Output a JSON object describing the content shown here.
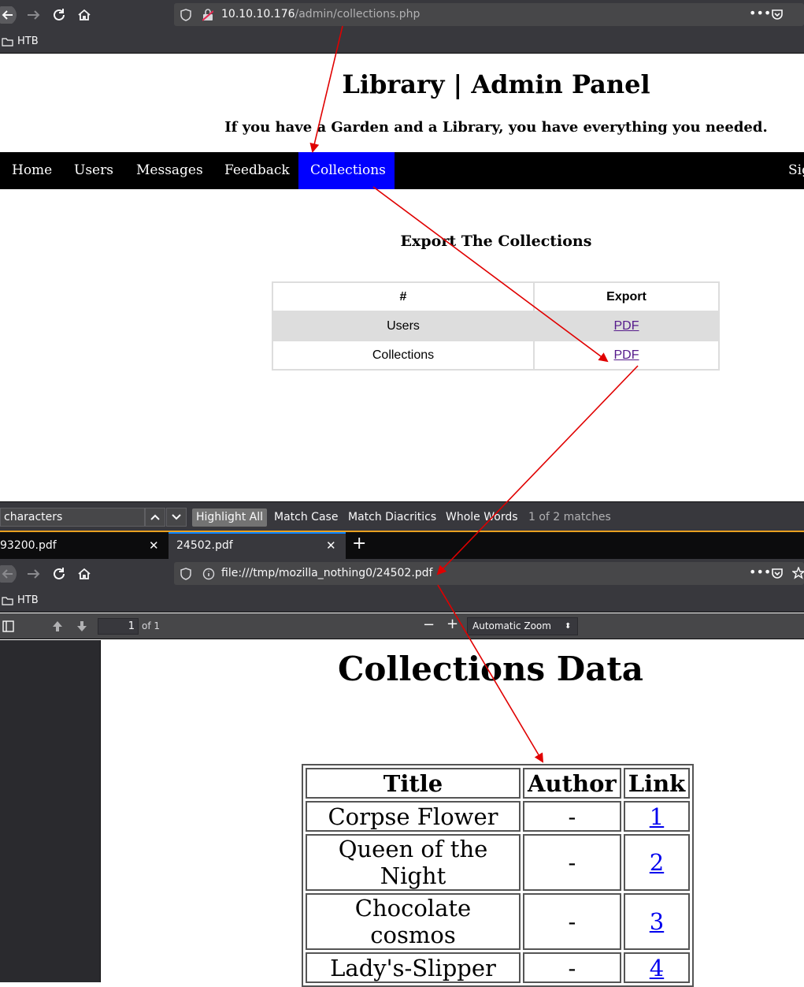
{
  "browser_top": {
    "url_host": "10.10.10.176",
    "url_path": "/admin/collections.php",
    "bookmark": "HTB"
  },
  "admin": {
    "title": "Library | Admin Panel",
    "subtitle": "If you have a Garden and a Library, you have everything you needed.",
    "nav": [
      "Home",
      "Users",
      "Messages",
      "Feedback",
      "Collections",
      "Sig"
    ],
    "active_nav": "Collections",
    "section_title": "Export The Collections",
    "table": {
      "headers": [
        "#",
        "Export"
      ],
      "rows": [
        {
          "name": "Users",
          "link": "PDF"
        },
        {
          "name": "Collections",
          "link": "PDF"
        }
      ]
    }
  },
  "findbar": {
    "query": "characters",
    "highlight_all": "Highlight All",
    "match_case": "Match Case",
    "match_diacritics": "Match Diacritics",
    "whole_words": "Whole Words",
    "count": "1 of 2 matches"
  },
  "tabs": [
    {
      "label": "93200.pdf"
    },
    {
      "label": "24502.pdf"
    }
  ],
  "browser_bottom": {
    "url": "file:///tmp/mozilla_nothing0/24502.pdf",
    "bookmark": "HTB"
  },
  "pdf_toolbar": {
    "page": "1",
    "of_pages": "of 1",
    "zoom": "Automatic Zoom"
  },
  "pdf": {
    "title": "Collections Data",
    "headers": [
      "Title",
      "Author",
      "Link"
    ],
    "rows": [
      {
        "title": "Corpse Flower",
        "author": "-",
        "link": "1"
      },
      {
        "title": "Queen of the Night",
        "author": "-",
        "link": "2"
      },
      {
        "title": "Chocolate cosmos",
        "author": "-",
        "link": "3"
      },
      {
        "title": "Lady's-Slipper",
        "author": "-",
        "link": "4"
      }
    ]
  },
  "colors": {
    "annotation_arrow": "#e00000",
    "nav_active": "#0000ff",
    "chrome_dark": "#38383d"
  }
}
